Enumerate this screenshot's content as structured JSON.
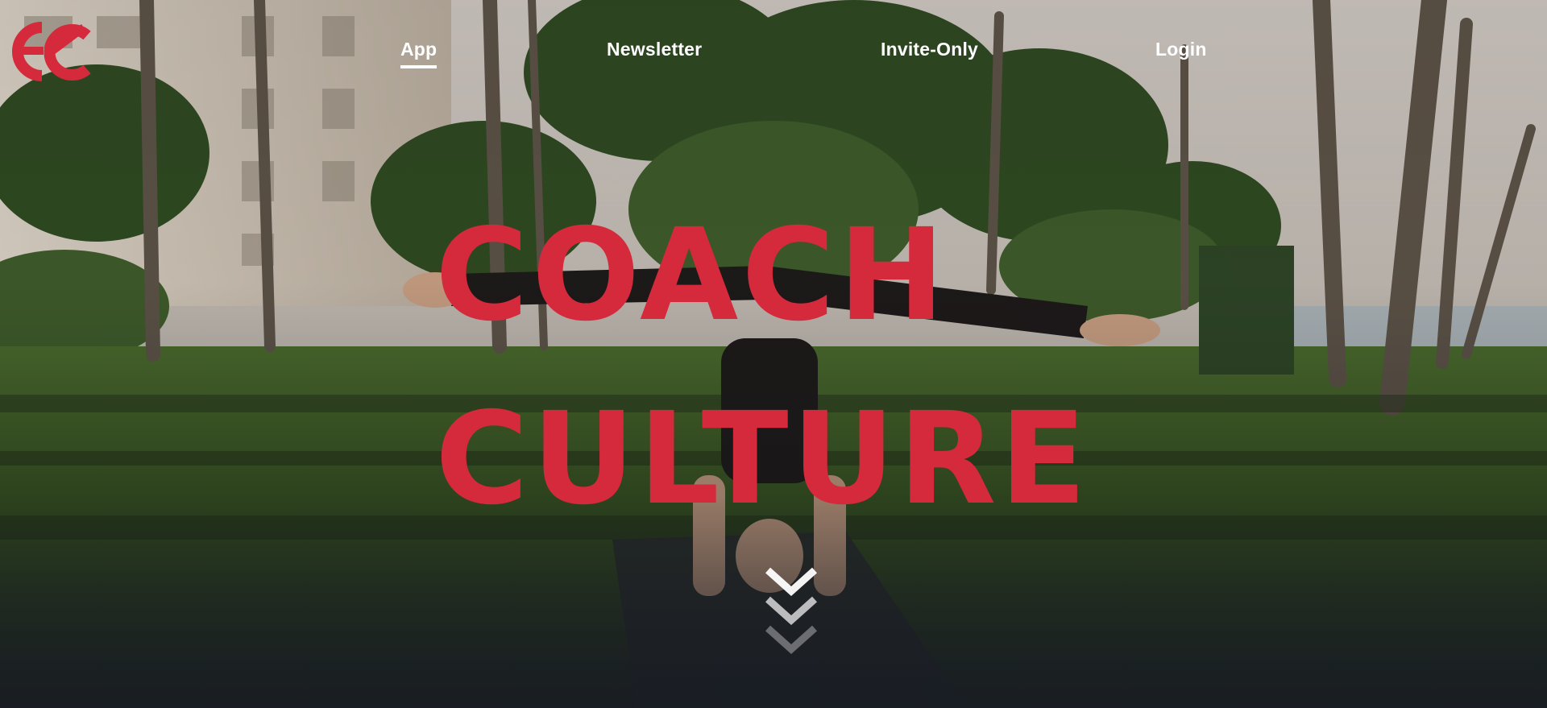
{
  "logo": {
    "icon": "cc-monogram-icon",
    "color": "#d42a3b"
  },
  "nav": {
    "items": [
      {
        "label": "App",
        "active": true
      },
      {
        "label": "Newsletter",
        "active": false
      },
      {
        "label": "Invite-Only",
        "active": false
      },
      {
        "label": "Login",
        "active": false
      }
    ]
  },
  "hero": {
    "title_line1": "Coach",
    "title_line2": "Culture",
    "title_color": "#d42a3b",
    "scroll_icon": "chevrons-down-icon"
  }
}
